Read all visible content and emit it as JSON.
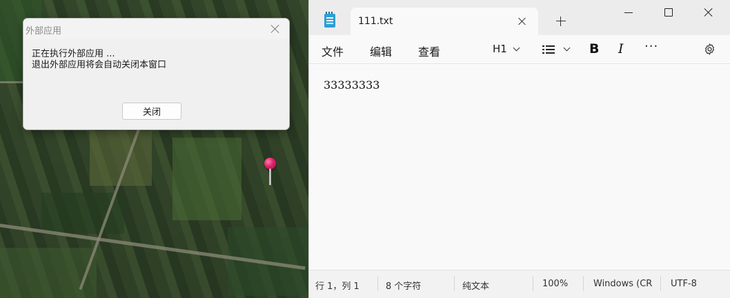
{
  "dialog": {
    "title": "外部应用",
    "message_line1": "正在执行外部应用 ...",
    "message_line2": "退出外部应用将会自动关闭本窗口",
    "close_button_label": "关闭"
  },
  "notepad": {
    "tab": {
      "label": "111.txt"
    },
    "menu": {
      "file": "文件",
      "edit": "编辑",
      "view": "查看"
    },
    "toolbar": {
      "heading": "H1"
    },
    "content": "33333333",
    "status": {
      "position": "行 1，列 1",
      "char_count": "8 个字符",
      "format": "纯文本",
      "zoom": "100%",
      "line_ending": "Windows (CR",
      "encoding": "UTF-8"
    }
  },
  "icons": {
    "app": "notepad-icon",
    "pin": "map-pin-icon",
    "gear": "gear-icon"
  },
  "colors": {
    "pin": "#e0206a",
    "app_icon": "#2a9fd6"
  }
}
